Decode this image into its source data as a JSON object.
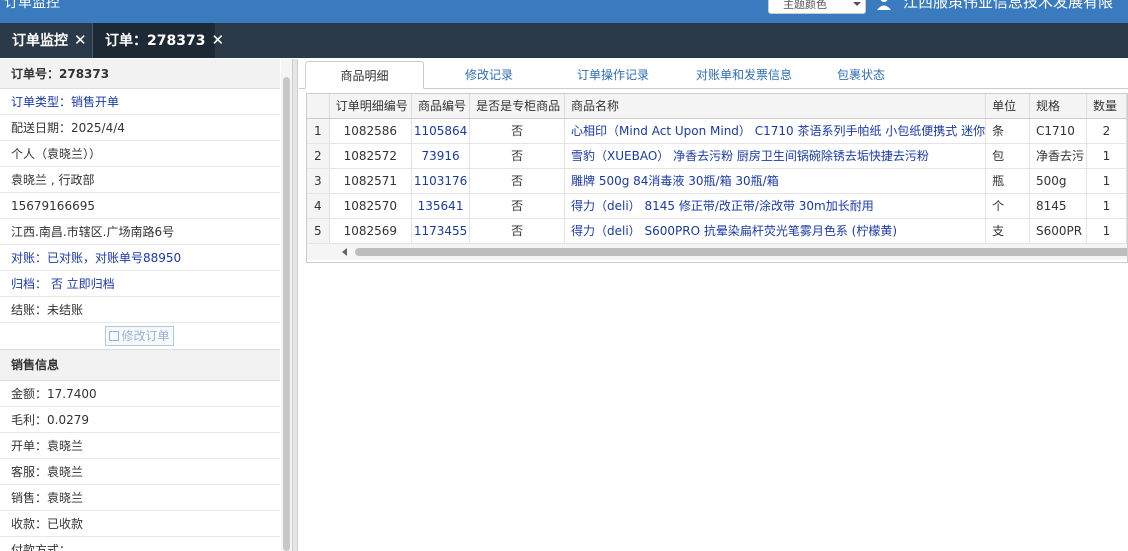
{
  "header": {
    "app_title": "订单监控",
    "theme_select": "主题颜色",
    "company": "江西服策伟业信息技术发展有限"
  },
  "tabs": [
    {
      "label": "订单监控"
    },
    {
      "label": "订单：278373"
    }
  ],
  "order_info": {
    "order_no": "订单号：278373",
    "rows": [
      {
        "text": "订单类型：销售开单",
        "blue": true
      },
      {
        "text": "配送日期：2025/4/4",
        "blue": false
      },
      {
        "text": "个人（袁晓兰））",
        "blue": false
      },
      {
        "text": "袁晓兰 , 行政部",
        "blue": false
      },
      {
        "text": "15679166695",
        "blue": false
      },
      {
        "text": "江西.南昌.市辖区.广场南路6号",
        "blue": false
      },
      {
        "text": "对账：已对账，对账单号88950",
        "blue": true
      },
      {
        "text": "归档：  否 立即归档",
        "blue": true
      },
      {
        "text": "结账：未结账",
        "blue": false
      }
    ],
    "edit_button": "修改订单"
  },
  "sales_info": {
    "title": "销售信息",
    "rows": [
      "金额：17.7400",
      "毛利：0.0279",
      "开单：袁晓兰",
      "客服：袁晓兰",
      "销售：袁晓兰",
      "收款：已收款",
      "付款方式："
    ]
  },
  "subtabs": [
    "商品明细",
    "修改记录",
    "订单操作记录",
    "对账单和发票信息",
    "包裹状态"
  ],
  "grid": {
    "columns": [
      "",
      "订单明细编号",
      "商品编号",
      "是否是专柜商品",
      "商品名称",
      "单位",
      "规格",
      "数量"
    ],
    "rows": [
      [
        "1",
        "1082586",
        "1105864",
        "否",
        "心相印（Mind Act Upon Mind） C1710 茶语系列手帕纸 小包纸便携式 迷你",
        "条",
        "C1710",
        "2"
      ],
      [
        "2",
        "1082572",
        "73916",
        "否",
        "雪豹（XUEBAO） 净香去污粉 厨房卫生间锅碗除锈去垢快捷去污粉",
        "包",
        "净香去污",
        "1"
      ],
      [
        "3",
        "1082571",
        "1103176",
        "否",
        "雕牌 500g 84消毒液 30瓶/箱 30瓶/箱",
        "瓶",
        "500g",
        "1"
      ],
      [
        "4",
        "1082570",
        "135641",
        "否",
        "得力（deli） 8145 修正带/改正带/涂改带 30m加长耐用",
        "个",
        "8145",
        "1"
      ],
      [
        "5",
        "1082569",
        "1173455",
        "否",
        "得力（deli） S600PRO 抗晕染扁杆荧光笔雾月色系 (柠檬黄)",
        "支",
        "S600PR",
        "1"
      ]
    ]
  }
}
